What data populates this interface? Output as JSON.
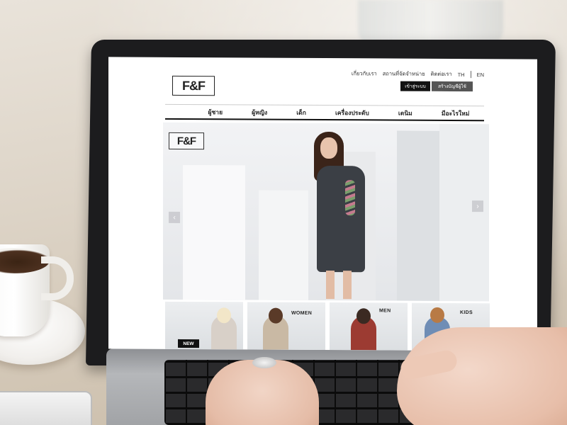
{
  "site": {
    "logo": "F&F",
    "top_links": [
      "เกี่ยวกับเรา",
      "สถานที่จัดจำหน่าย",
      "ติดต่อเรา"
    ],
    "languages": [
      "TH",
      "EN"
    ],
    "login_label": "เข้าสู่ระบบ",
    "register_label": "สร้างบัญชีผู้ใช้",
    "nav": [
      "ผู้ชาย",
      "ผู้หญิง",
      "เด็ก",
      "เครื่องประดับ",
      "เดนิม",
      "มีอะไรใหม่"
    ],
    "hero": {
      "logo": "F&F",
      "prev_arrow": "‹",
      "next_arrow": "›"
    },
    "categories": {
      "new_badge": "NEW",
      "women": "WOMEN",
      "men": "MEN",
      "kids": "KIDS"
    }
  },
  "icons": [
    "chevron-left-icon",
    "chevron-right-icon"
  ]
}
